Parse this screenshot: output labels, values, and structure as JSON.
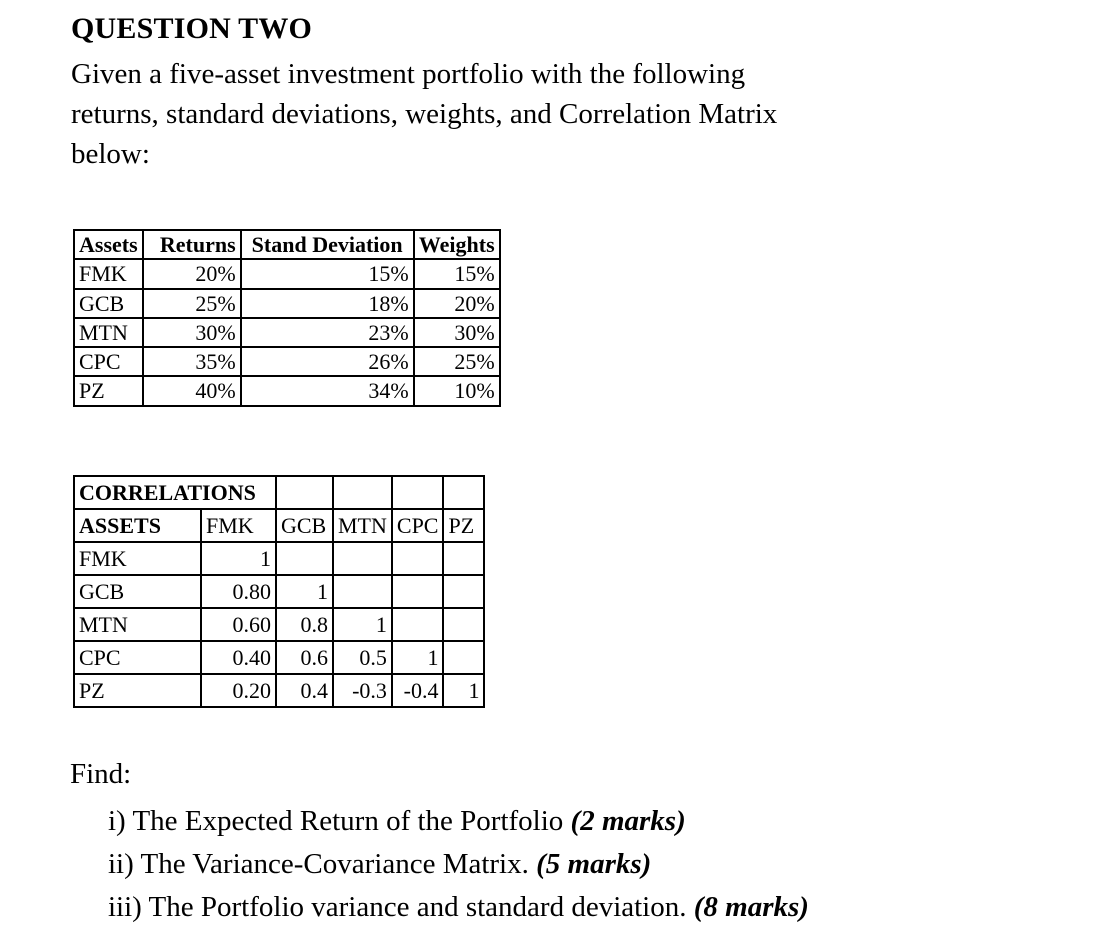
{
  "document": {
    "title": "QUESTION TWO",
    "intro_lines": [
      "Given a five-asset investment portfolio with the following",
      "returns, standard deviations, weights, and Correlation Matrix",
      "below:"
    ],
    "intro_full": "Given a five-asset investment portfolio with the following returns, standard deviations, weights, and Correlation Matrix below:"
  },
  "asset_table": {
    "headers": [
      "Assets",
      "Returns",
      "Stand Deviation",
      "Weights"
    ],
    "rows": [
      [
        "FMK",
        "20%",
        "15%",
        "15%"
      ],
      [
        "GCB",
        "25%",
        "18%",
        "20%"
      ],
      [
        "MTN",
        "30%",
        "23%",
        "30%"
      ],
      [
        "CPC",
        "35%",
        "26%",
        "25%"
      ],
      [
        "PZ",
        "40%",
        "34%",
        "10%"
      ]
    ]
  },
  "correlation_table": {
    "title": "CORRELATIONS",
    "header_label": "ASSETS",
    "column_headers": [
      "FMK",
      "GCB",
      "MTN",
      "CPC",
      "PZ"
    ],
    "rows": [
      {
        "name": "FMK",
        "values": [
          "1",
          "",
          "",
          "",
          ""
        ]
      },
      {
        "name": "GCB",
        "values": [
          "0.80",
          "1",
          "",
          "",
          ""
        ]
      },
      {
        "name": "MTN",
        "values": [
          "0.60",
          "0.8",
          "1",
          "",
          ""
        ]
      },
      {
        "name": "CPC",
        "values": [
          "0.40",
          "0.6",
          "0.5",
          "1",
          ""
        ]
      },
      {
        "name": "PZ",
        "values": [
          "0.20",
          "0.4",
          "-0.3",
          "-0.4",
          "1"
        ]
      }
    ]
  },
  "find": {
    "label": "Find:",
    "items": [
      {
        "text": "i) The Expected Return of the Portfolio ",
        "marks": "(2 marks)"
      },
      {
        "text": "ii) The Variance-Covariance Matrix. ",
        "marks": "(5 marks)"
      },
      {
        "text": "iii) The Portfolio variance and standard deviation. ",
        "marks": "(8 marks)"
      }
    ]
  },
  "colors": {
    "text": "#000000",
    "background": "#ffffff",
    "table_border": "#000000"
  }
}
